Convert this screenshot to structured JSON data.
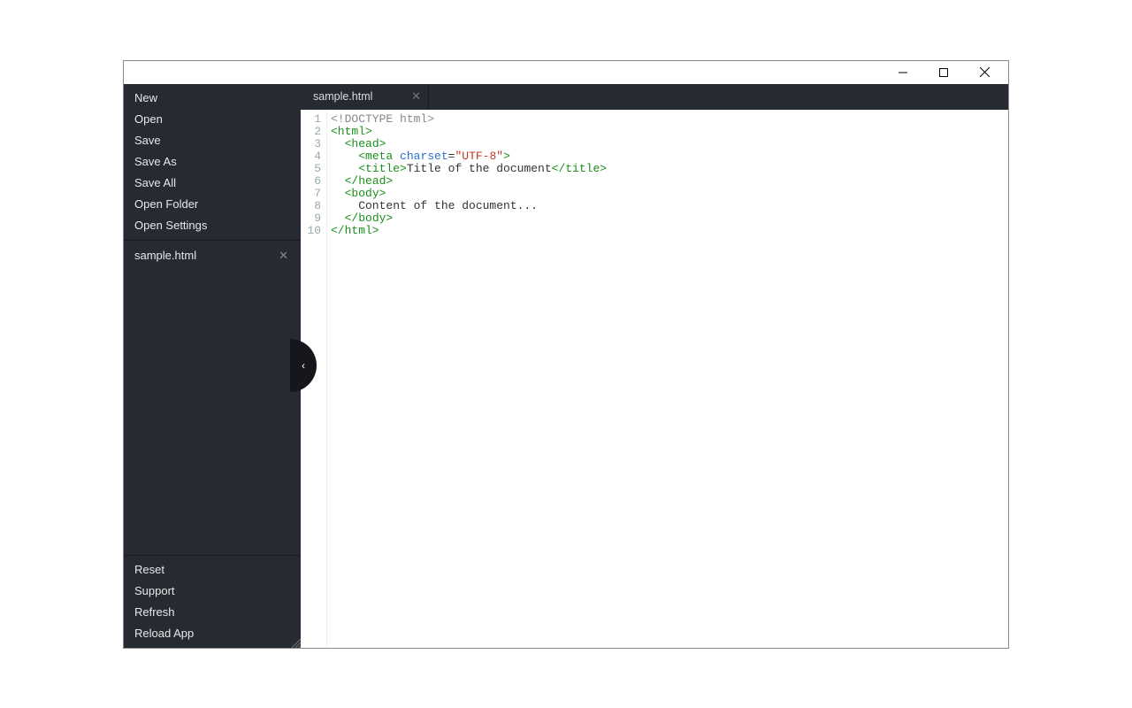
{
  "sidebar": {
    "top_items": [
      "New",
      "Open",
      "Save",
      "Save As",
      "Save All",
      "Open Folder",
      "Open Settings"
    ],
    "open_files": [
      {
        "name": "sample.html"
      }
    ],
    "bottom_items": [
      "Reset",
      "Support",
      "Refresh",
      "Reload App"
    ],
    "collapse_glyph": "‹"
  },
  "tabs": [
    {
      "name": "sample.html"
    }
  ],
  "editor": {
    "line_count": 10,
    "lines": [
      [
        {
          "t": "decl",
          "v": "<!DOCTYPE html>"
        }
      ],
      [
        {
          "t": "tag",
          "v": "<html>"
        }
      ],
      [
        {
          "t": "text",
          "v": "  "
        },
        {
          "t": "tag",
          "v": "<head>"
        }
      ],
      [
        {
          "t": "text",
          "v": "    "
        },
        {
          "t": "tag",
          "v": "<meta"
        },
        {
          "t": "text",
          "v": " "
        },
        {
          "t": "attr",
          "v": "charset"
        },
        {
          "t": "text",
          "v": "="
        },
        {
          "t": "str",
          "v": "\"UTF-8\""
        },
        {
          "t": "tag",
          "v": ">"
        }
      ],
      [
        {
          "t": "text",
          "v": "    "
        },
        {
          "t": "tag",
          "v": "<title>"
        },
        {
          "t": "text",
          "v": "Title of the document"
        },
        {
          "t": "tag",
          "v": "</title>"
        }
      ],
      [
        {
          "t": "text",
          "v": "  "
        },
        {
          "t": "tag",
          "v": "</head>"
        }
      ],
      [
        {
          "t": "text",
          "v": "  "
        },
        {
          "t": "tag",
          "v": "<body>"
        }
      ],
      [
        {
          "t": "text",
          "v": "    Content of the document..."
        }
      ],
      [
        {
          "t": "text",
          "v": "  "
        },
        {
          "t": "tag",
          "v": "</body>"
        }
      ],
      [
        {
          "t": "tag",
          "v": "</html>"
        }
      ]
    ]
  }
}
